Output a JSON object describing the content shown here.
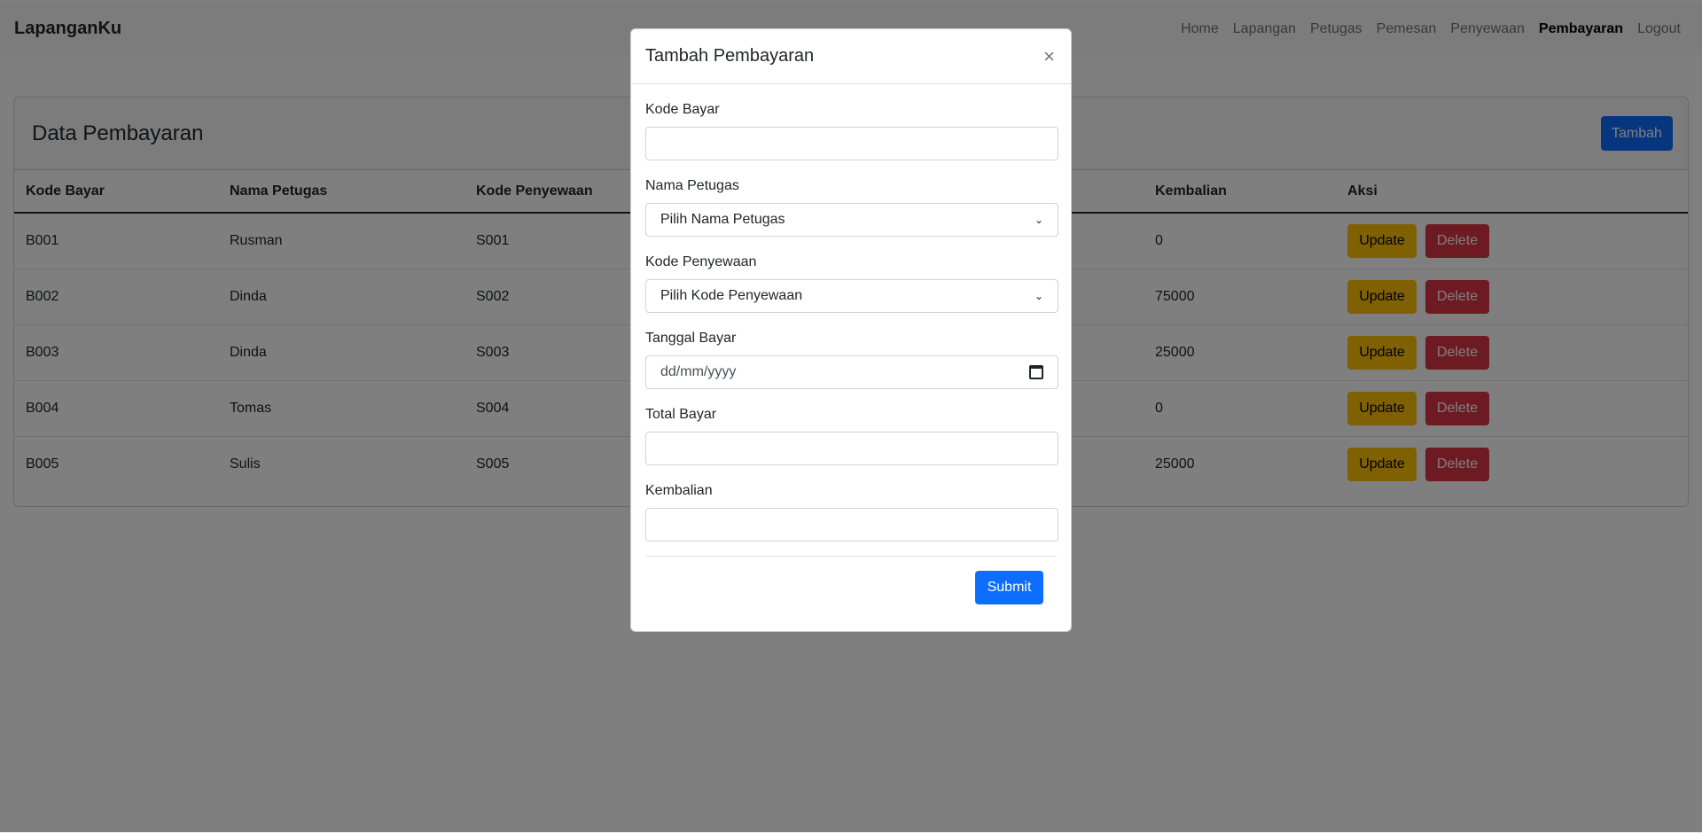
{
  "navbar": {
    "brand": "LapanganKu",
    "links": [
      {
        "label": "Home",
        "active": false
      },
      {
        "label": "Lapangan",
        "active": false
      },
      {
        "label": "Petugas",
        "active": false
      },
      {
        "label": "Pemesan",
        "active": false
      },
      {
        "label": "Penyewaan",
        "active": false
      },
      {
        "label": "Pembayaran",
        "active": true
      },
      {
        "label": "Logout",
        "active": false
      }
    ]
  },
  "card": {
    "title": "Data Pembayaran",
    "add_label": "Tambah"
  },
  "table": {
    "headers": [
      "Kode Bayar",
      "Nama Petugas",
      "Kode Penyewaan",
      "",
      "",
      "Kembalian",
      "Aksi"
    ],
    "rows": [
      {
        "kode": "B001",
        "petugas": "Rusman",
        "penyewaan": "S001",
        "kembalian": "0"
      },
      {
        "kode": "B002",
        "petugas": "Dinda",
        "penyewaan": "S002",
        "kembalian": "75000"
      },
      {
        "kode": "B003",
        "petugas": "Dinda",
        "penyewaan": "S003",
        "kembalian": "25000"
      },
      {
        "kode": "B004",
        "petugas": "Tomas",
        "penyewaan": "S004",
        "kembalian": "0"
      },
      {
        "kode": "B005",
        "petugas": "Sulis",
        "penyewaan": "S005",
        "kembalian": "25000"
      }
    ],
    "update_label": "Update",
    "delete_label": "Delete"
  },
  "modal": {
    "title": "Tambah Pembayaran",
    "close_glyph": "×",
    "fields": {
      "kode_bayar": {
        "label": "Kode Bayar",
        "value": ""
      },
      "nama_petugas": {
        "label": "Nama Petugas",
        "selected": "Pilih Nama Petugas"
      },
      "kode_penyewaan": {
        "label": "Kode Penyewaan",
        "selected": "Pilih Kode Penyewaan"
      },
      "tanggal_bayar": {
        "label": "Tanggal Bayar",
        "placeholder": "dd/mm/yyyy"
      },
      "total_bayar": {
        "label": "Total Bayar",
        "value": ""
      },
      "kembalian": {
        "label": "Kembalian",
        "value": ""
      }
    },
    "submit_label": "Submit"
  },
  "colors": {
    "primary": "#0d6efd",
    "warning": "#ffc107",
    "danger": "#dc3545",
    "backdrop": "rgba(0,0,0,0.5)"
  }
}
